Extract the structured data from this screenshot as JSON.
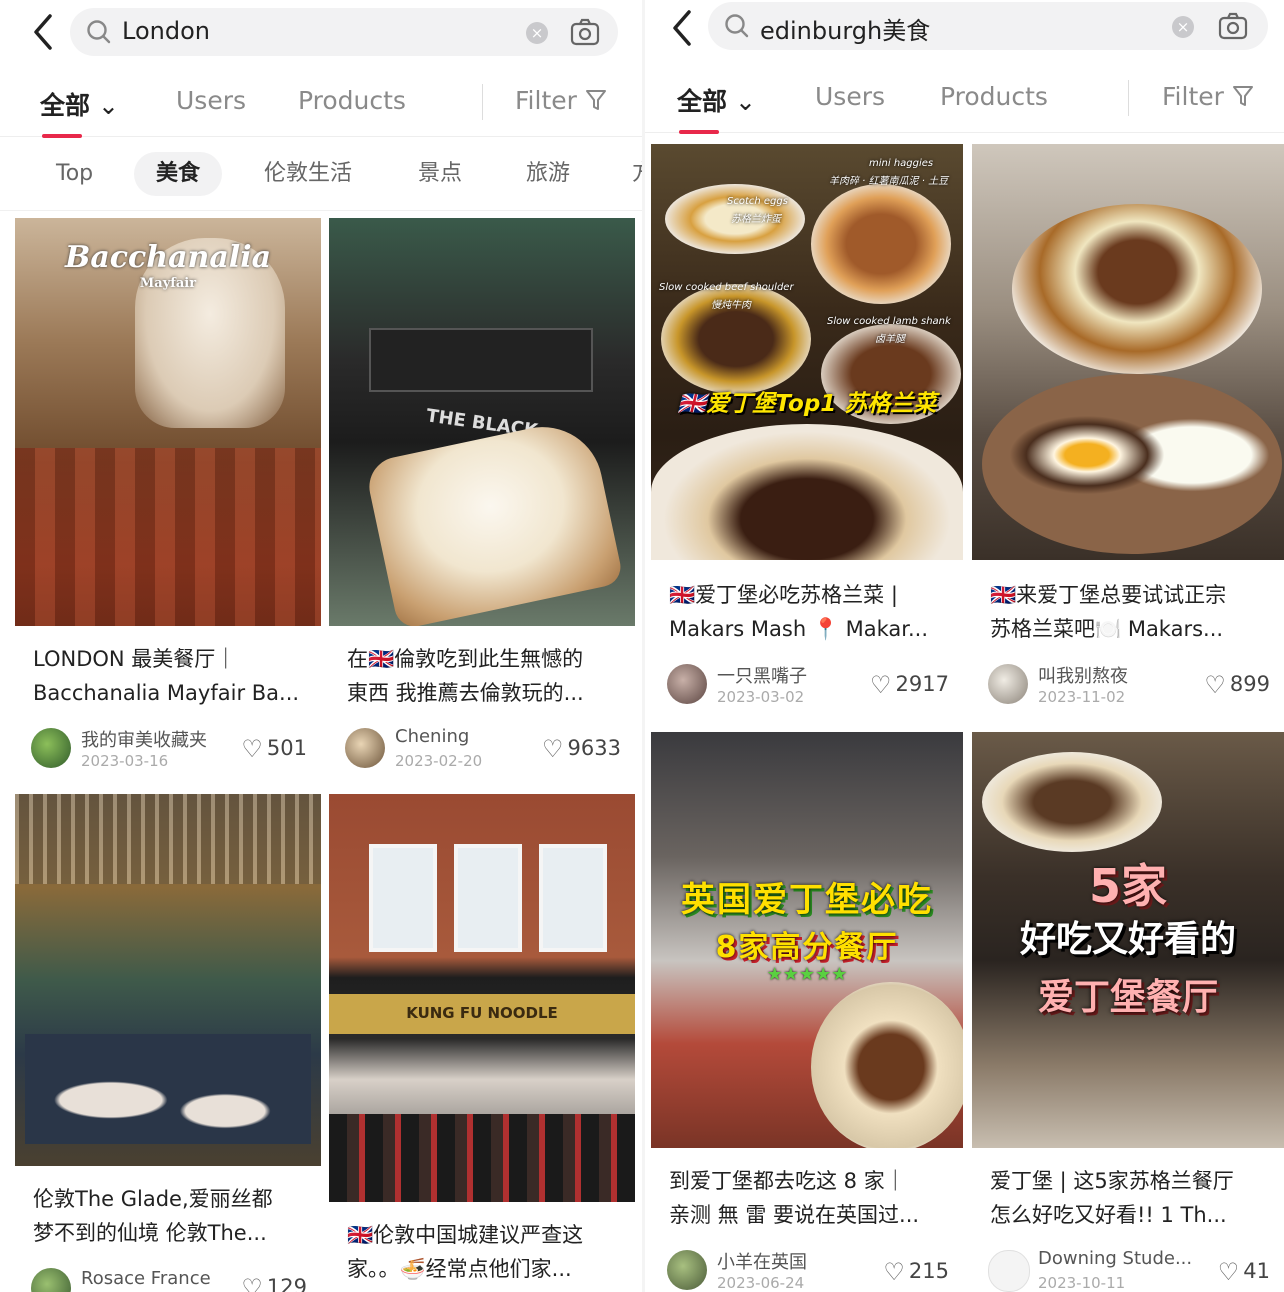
{
  "left": {
    "search": {
      "query": "London"
    },
    "tabs": {
      "all": "全部",
      "users": "Users",
      "products": "Products",
      "filter": "Filter"
    },
    "chips": [
      "Top",
      "美食",
      "伦敦生活",
      "景点",
      "旅游",
      "方"
    ],
    "cards": [
      {
        "overlay": "Bacchanalia",
        "overlay2": "Mayfair",
        "title1": "LONDON 最美餐厅｜",
        "title2": "Bacchanalia Mayfair Ba...",
        "author": "我的审美收藏夹",
        "date": "2023-03-16",
        "likes": "501"
      },
      {
        "overlay": "THE BLACK",
        "title1": "在🇬🇧倫敦吃到此生無憾的",
        "title2": "東西 我推薦去倫敦玩的...",
        "author": "Chening",
        "date": "2023-02-20",
        "likes": "9633"
      },
      {
        "title1": "伦敦The Glade,爱丽丝都",
        "title2": "梦不到的仙境 伦敦The...",
        "author": "Rosace France",
        "likes": "129"
      },
      {
        "overlay": "KUNG FU NOODLE",
        "title1": "🇬🇧伦敦中国城建议严查这",
        "title2": "家。。🍜经常点他们家..."
      }
    ]
  },
  "right": {
    "search": {
      "query": "edinburgh美食"
    },
    "tabs": {
      "all": "全部",
      "users": "Users",
      "products": "Products",
      "filter": "Filter"
    },
    "cards": [
      {
        "overlay": "🇬🇧爱丁堡Top1 苏格兰菜",
        "tag1": "mini haggies",
        "tag2": "羊肉碎 · 红薯南瓜泥 · 土豆",
        "tag3": "Scotch eggs",
        "tag4": "苏格兰炸蛋",
        "tag5": "Slow cooked beef shoulder",
        "tag6": "慢炖牛肉",
        "tag7": "Slow cooked lamb shank",
        "tag8": "卤羊腿",
        "title1": "🇬🇧爱丁堡必吃苏格兰菜 |",
        "title2": "Makars Mash 📍 Makar...",
        "author": "一只黑嘴子",
        "date": "2023-03-02",
        "likes": "2917"
      },
      {
        "title1": "🇬🇧来爱丁堡总要试试正宗",
        "title2": "苏格兰菜吧🍽️ Makars...",
        "author": "叫我别熬夜",
        "date": "2023-11-02",
        "likes": "899"
      },
      {
        "overlay": "英国爱丁堡必吃",
        "overlay2": "8家高分餐厅",
        "stars": "★★★★★",
        "title1": "到爱丁堡都去吃这 8 家｜",
        "title2": "亲测 無 雷 要说在英国过...",
        "author": "小羊在英国",
        "date": "2023-06-24",
        "likes": "215"
      },
      {
        "overlay": "5家",
        "overlay2": "好吃又好看的",
        "overlay3": "爱丁堡餐厅",
        "title1": "爱丁堡 | 这5家苏格兰餐厅",
        "title2": "怎么好吃又好看!! 1 Th...",
        "author": "Downing Stude...",
        "date": "2023-10-11",
        "likes": "41"
      }
    ]
  },
  "colors": {
    "accent": "#e8284a",
    "search_bg": "#f2f2f3"
  }
}
